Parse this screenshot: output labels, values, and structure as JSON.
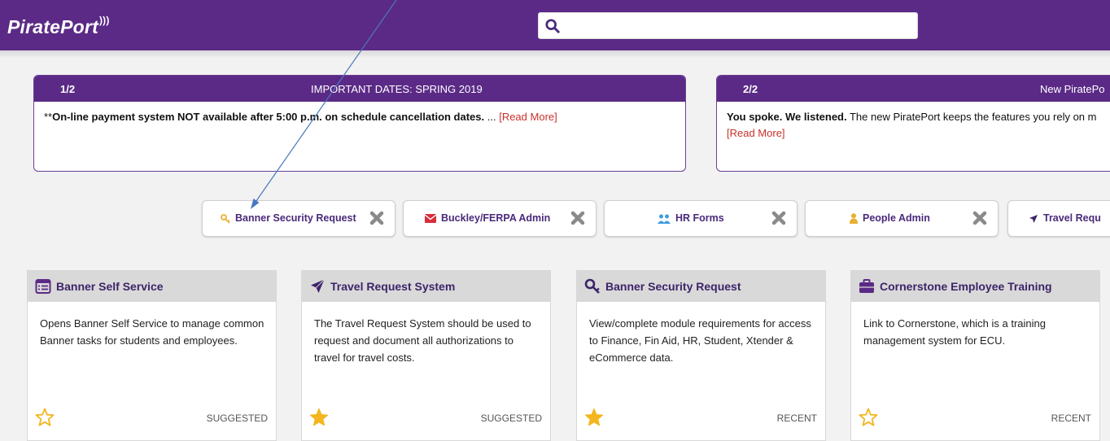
{
  "header": {
    "logo_text": "PiratePort",
    "search": {
      "value": "",
      "placeholder": ""
    },
    "brand_color": "#5b2a86"
  },
  "announcements": [
    {
      "number": "1/2",
      "title": "IMPORTANT DATES: SPRING 2019",
      "body_prefix": "**",
      "body_bold": "On-line payment system NOT available after 5:00 p.m. on schedule cancellation dates.",
      "body_rest": " ... ",
      "read_more": "[Read More]"
    },
    {
      "number": "2/2",
      "title": "New PiratePo",
      "body_bold": "You spoke. We listened.",
      "body_rest": " The new PiratePort keeps the features you rely on m",
      "read_more": "[Read More]"
    }
  ],
  "quick_links": [
    {
      "label": "Banner Security Request",
      "icon": "key-icon",
      "icon_color": "#e8b030"
    },
    {
      "label": "Buckley/FERPA Admin",
      "icon": "envelope-icon",
      "icon_color": "#d62f3a"
    },
    {
      "label": "HR Forms",
      "icon": "users-icon",
      "icon_color": "#3d9be0"
    },
    {
      "label": "People Admin",
      "icon": "user-icon",
      "icon_color": "#e8b030"
    },
    {
      "label": "Travel Requ",
      "icon": "plane-icon",
      "icon_color": "#3d2469"
    }
  ],
  "cards": [
    {
      "title": "Banner Self Service",
      "icon": "list-icon",
      "description": "Opens Banner Self Service to manage common Banner tasks for students and employees.",
      "favorite": false,
      "status": "SUGGESTED"
    },
    {
      "title": "Travel Request System",
      "icon": "plane-icon",
      "description": "The Travel Request System should be used to request and document all authorizations to travel for travel costs.",
      "favorite": true,
      "status": "SUGGESTED"
    },
    {
      "title": "Banner Security Request",
      "icon": "key-icon",
      "description": "View/complete module requirements for access to Finance, Fin Aid, HR, Student, Xtender & eCommerce data.",
      "favorite": true,
      "status": "RECENT"
    },
    {
      "title": "Cornerstone Employee Training",
      "icon": "briefcase-icon",
      "description": "Link to Cornerstone, which is a training management system for ECU.",
      "favorite": false,
      "status": "RECENT"
    }
  ],
  "colors": {
    "star_gold": "#f3b61f",
    "read_more": "#c9312b",
    "card_title": "#3d2469"
  }
}
